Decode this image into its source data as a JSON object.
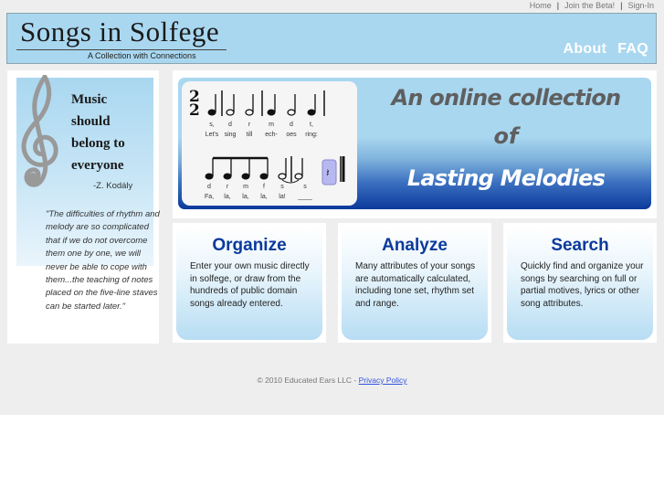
{
  "top_links": [
    "Home",
    "Join the Beta!",
    "Sign-In"
  ],
  "header": {
    "logo_title": "Songs in Solfege",
    "logo_subtitle": "A Collection with Connections",
    "nav": [
      "About",
      "FAQ"
    ],
    "bg_color": "#a9d7f0"
  },
  "sidebar": {
    "motto_lines": [
      "Music",
      "should",
      "belong to",
      "everyone"
    ],
    "motto_author": "-Z. Kodály",
    "long_quote": "\"The difficulties of rhythm and melody are so complicated that if we do not overcome them one by one, we will never be able to cope with them...the teaching of notes placed on the five-line staves can be started later.\""
  },
  "hero": {
    "time_signature": [
      "2",
      "2"
    ],
    "line1_solfege": [
      "s,",
      "d",
      "r",
      "m",
      "d",
      "t,"
    ],
    "line1_lyrics": [
      "Let's",
      "sing",
      "till",
      "ech-",
      "oes",
      "ring:"
    ],
    "line2_solfege": [
      "d",
      "r",
      "m",
      "f",
      "s",
      "s"
    ],
    "line2_lyrics": [
      "Fa,",
      "la,",
      "la,",
      "la,",
      "la!",
      "____"
    ],
    "headline_1": "An online collection",
    "headline_2": "of",
    "headline_3": "Lasting Melodies"
  },
  "features": [
    {
      "title": "Organize",
      "text": "Enter your own music directly in solfege, or draw from the hundreds of public domain songs already entered."
    },
    {
      "title": "Analyze",
      "text": "Many attributes of your songs are automatically calculated, including tone set, rhythm set and range."
    },
    {
      "title": "Search",
      "text": "Quickly find and organize your songs by searching on full or partial motives, lyrics or other song attributes."
    }
  ],
  "footer": {
    "copyright": "© 2010 Educated Ears LLC - ",
    "privacy_link": "Privacy Policy"
  }
}
